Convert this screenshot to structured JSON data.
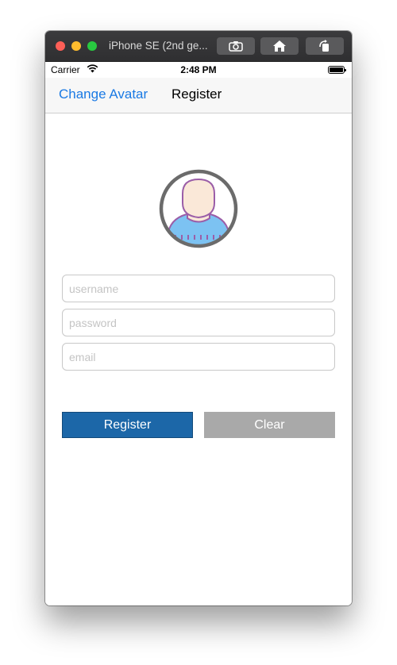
{
  "window": {
    "title": "iPhone SE (2nd ge..."
  },
  "statusbar": {
    "carrier": "Carrier",
    "time": "2:48 PM"
  },
  "navbar": {
    "back_label": "Change Avatar",
    "title": "Register"
  },
  "form": {
    "username_placeholder": "username",
    "password_placeholder": "password",
    "email_placeholder": "email",
    "username_value": "",
    "password_value": "",
    "email_value": ""
  },
  "buttons": {
    "register_label": "Register",
    "clear_label": "Clear"
  },
  "icons": {
    "screenshot": "camera-icon",
    "home": "home-icon",
    "rotate": "rotate-icon",
    "wifi": "wifi-icon",
    "battery": "battery-icon",
    "avatar": "avatar-person-icon"
  },
  "colors": {
    "accent": "#1a7ae4",
    "register_button": "#1c67a8",
    "clear_button": "#a9a9a9",
    "avatar_shirt": "#7cc2f2",
    "avatar_skin": "#fae8d8",
    "avatar_outline": "#9b5ea8"
  }
}
